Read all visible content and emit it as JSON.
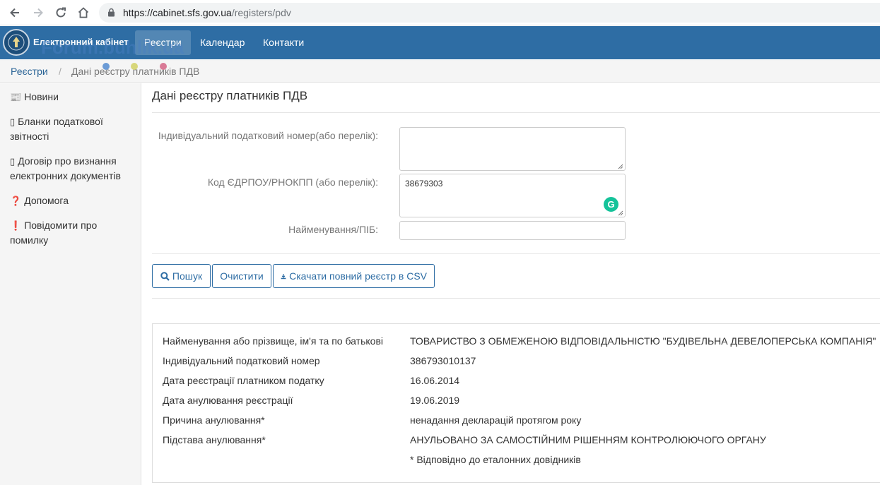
{
  "browser": {
    "url_host": "https://cabinet.sfs.gov.ua",
    "url_path": "/registers/pdv"
  },
  "navbar": {
    "brand": "Електронний кабінет",
    "watermark": "Forum.buhlik.ua",
    "items": [
      "Реєстри",
      "Календар",
      "Контакти"
    ]
  },
  "breadcrumb": {
    "root": "Реєстри",
    "separator": "/",
    "current": "Дані реєстру платників ПДВ"
  },
  "sidebar": {
    "items": [
      {
        "icon": "newspaper-icon",
        "label": "Новини"
      },
      {
        "icon": "book-icon",
        "label": "Бланки податкової звітності"
      },
      {
        "icon": "book-icon",
        "label": "Договір про визнання електронних документів"
      },
      {
        "icon": "question-circle-icon",
        "label": "Допомога"
      },
      {
        "icon": "exclamation-circle-icon",
        "label": "Повідомити про помилку"
      }
    ]
  },
  "main": {
    "title": "Дані реєстру платників ПДВ",
    "form": {
      "ipn_label": "Індивідуальний податковий номер(або перелік):",
      "ipn_value": "",
      "edrpou_label": "Код ЄДРПОУ/РНОКПП (або перелік):",
      "edrpou_value": "38679303",
      "name_label": "Найменування/ПІБ:",
      "name_value": ""
    },
    "buttons": {
      "search": "Пошук",
      "clear": "Очистити",
      "download": "Скачати повний реєстр в CSV"
    },
    "result": [
      {
        "label": "Найменування або прізвище, ім'я та по батькові",
        "value": "ТОВАРИСТВО З ОБМЕЖЕНОЮ ВІДПОВІДАЛЬНІСТЮ \"БУДІВЕЛЬНА ДЕВЕЛОПЕРСЬКА КОМПАНІЯ\""
      },
      {
        "label": "Індивідуальний податковий номер",
        "value": "386793010137"
      },
      {
        "label": "Дата реєстрації платником податку",
        "value": "16.06.2014"
      },
      {
        "label": "Дата анулювання реєстрації",
        "value": "19.06.2019"
      },
      {
        "label": "Причина анулювання*",
        "value": "ненадання декларацій протягом року"
      },
      {
        "label": "Підстава анулювання*",
        "value": "АНУЛЬОВАНО ЗА САМОСТІЙНИМ РІШЕННЯМ КОНТРОЛЮЮЧОГО ОРГАНУ"
      }
    ],
    "footnote": "* Відповідно до еталонних довідників"
  },
  "colors": {
    "navbar": "#2e6da4",
    "link": "#2a6496",
    "grammarly": "#15c39a"
  }
}
